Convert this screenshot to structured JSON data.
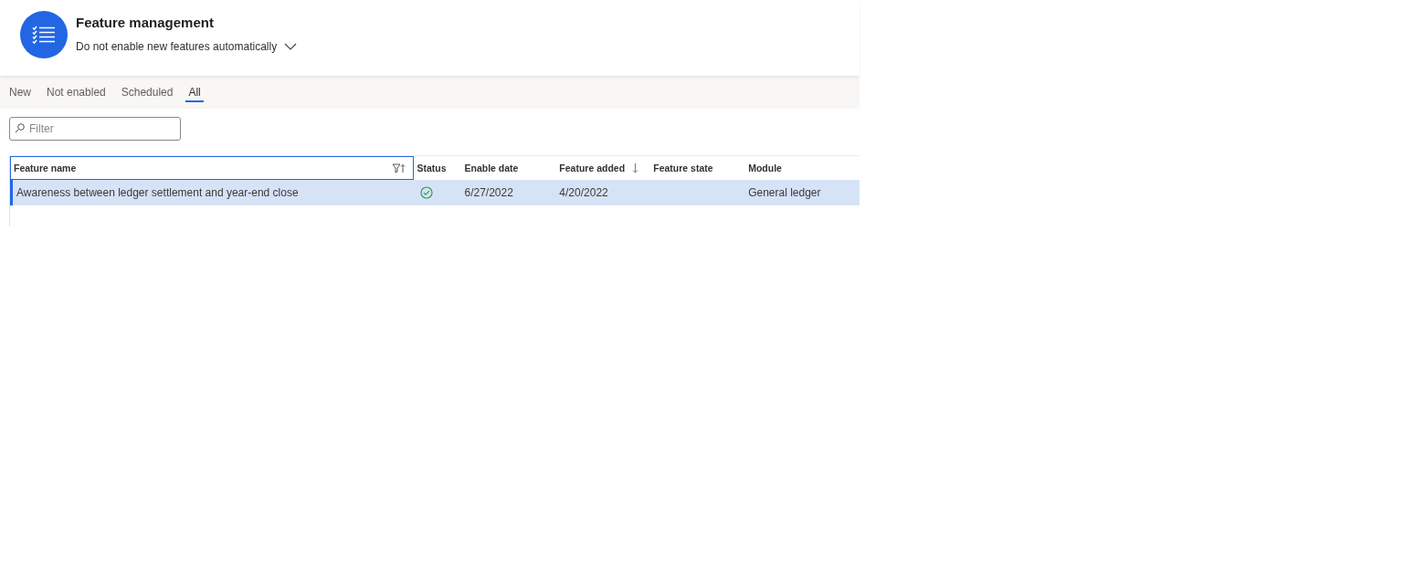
{
  "header": {
    "title": "Feature management",
    "setting": "Do not enable new features automatically"
  },
  "tabs": [
    {
      "label": "New",
      "selected": false
    },
    {
      "label": "Not enabled",
      "selected": false
    },
    {
      "label": "Scheduled",
      "selected": false
    },
    {
      "label": "All",
      "selected": true
    }
  ],
  "filter": {
    "placeholder": "Filter"
  },
  "table": {
    "columns": [
      {
        "label": "Feature name",
        "kind": "filter",
        "focused": true
      },
      {
        "label": "Status",
        "kind": "plain",
        "focused": false
      },
      {
        "label": "Enable date",
        "kind": "plain",
        "focused": false
      },
      {
        "label": "Feature added",
        "kind": "sorted",
        "focused": false
      },
      {
        "label": "Feature state",
        "kind": "plain",
        "focused": false
      },
      {
        "label": "Module",
        "kind": "plain",
        "focused": false
      }
    ],
    "rows": [
      {
        "selected": true,
        "feature_name": "Awareness between ledger settlement and year-end close",
        "enabled": true,
        "enable_date": "6/27/2022",
        "feature_added": "4/20/2022",
        "module": "General ledger"
      }
    ]
  }
}
